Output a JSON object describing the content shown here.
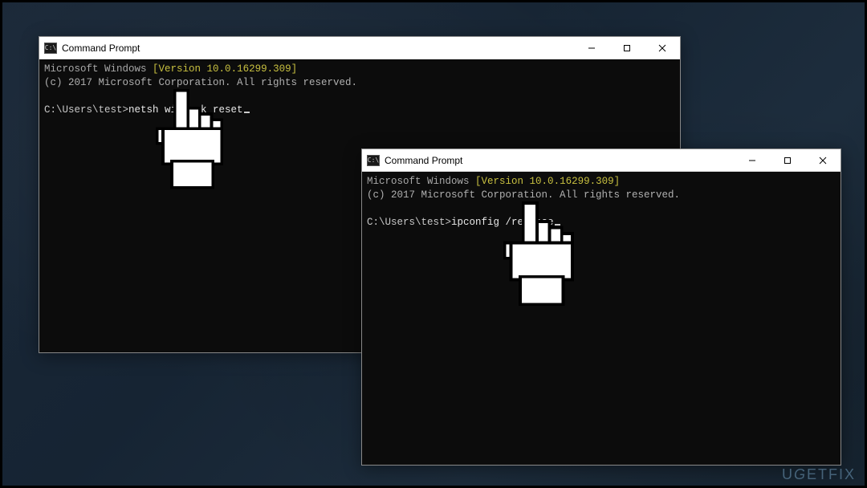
{
  "windows": [
    {
      "title": "Command Prompt",
      "icon_glyph": "C:\\",
      "version_prefix": "Microsoft Windows",
      "version_number": "[Version 10.0.16299.309]",
      "copyright": "(c) 2017 Microsoft Corporation. All rights reserved.",
      "prompt_path": "C:\\Users\\test>",
      "command": "netsh winsock reset"
    },
    {
      "title": "Command Prompt",
      "icon_glyph": "C:\\",
      "version_prefix": "Microsoft Windows",
      "version_number": "[Version 10.0.16299.309]",
      "copyright": "(c) 2017 Microsoft Corporation. All rights reserved.",
      "prompt_path": "C:\\Users\\test>",
      "command": "ipconfig /release"
    }
  ],
  "controls": {
    "minimize_label": "Minimize",
    "maximize_label": "Maximize",
    "close_label": "Close"
  },
  "watermark": "UGETFIX"
}
